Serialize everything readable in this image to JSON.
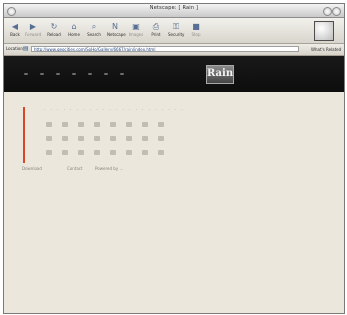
{
  "window": {
    "title": "Netscape: [ Rain ]"
  },
  "toolbar": {
    "items": [
      {
        "label": "Back",
        "icon": "back-arrow-icon",
        "disabled": false
      },
      {
        "label": "Forward",
        "icon": "forward-arrow-icon",
        "disabled": true
      },
      {
        "label": "Reload",
        "icon": "reload-icon",
        "disabled": false
      },
      {
        "label": "Home",
        "icon": "home-icon",
        "disabled": false
      },
      {
        "label": "Search",
        "icon": "search-icon",
        "disabled": false
      },
      {
        "label": "Netscape",
        "icon": "netscape-icon",
        "disabled": false
      },
      {
        "label": "Images",
        "icon": "images-icon",
        "disabled": true
      },
      {
        "label": "Print",
        "icon": "print-icon",
        "disabled": false
      },
      {
        "label": "Security",
        "icon": "security-lock-icon",
        "disabled": false
      },
      {
        "label": "Stop",
        "icon": "stop-icon",
        "disabled": true
      }
    ]
  },
  "location": {
    "label": "Location:",
    "url": "http://www.geocities.com/SoHo/Gallery/6667/rain/index.html",
    "related_label": "What's Related"
  },
  "site": {
    "logo_text": "Rain",
    "footer_left": "Download",
    "footer_middle": "Contact",
    "footer_right": "Powered by ...",
    "scribble": "· · · · · · · · · · · · · · · · · · · · · ·"
  },
  "colors": {
    "accent": "#d9472a",
    "header_bg": "#111111",
    "page_bg": "#ebe7dc",
    "link_blue": "#1e3f7a"
  }
}
